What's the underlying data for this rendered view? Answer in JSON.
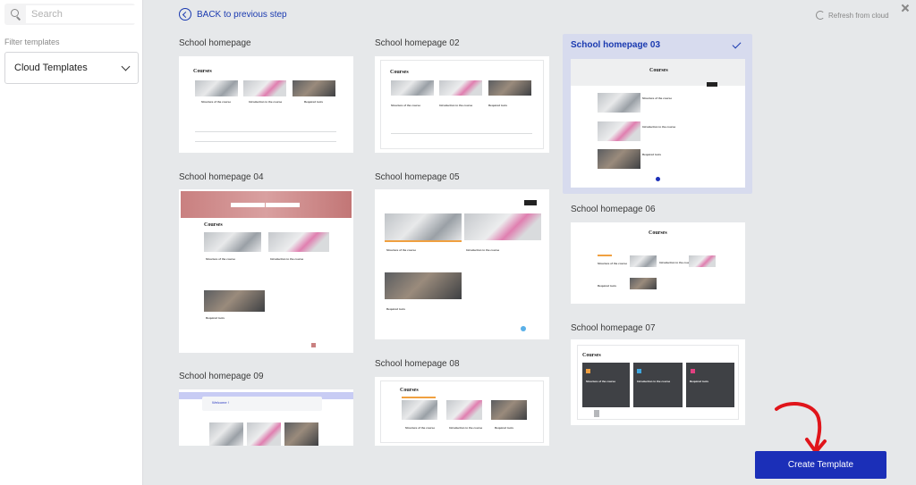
{
  "sidebar": {
    "search_placeholder": "Search",
    "filter_label": "Filter templates",
    "filter_value": "Cloud Templates"
  },
  "header": {
    "back_label": "BACK to previous step",
    "refresh_label": "Refresh from cloud"
  },
  "templates": [
    {
      "title": "School homepage",
      "selected": false
    },
    {
      "title": "School homepage 02",
      "selected": false
    },
    {
      "title": "School homepage 03",
      "selected": true
    },
    {
      "title": "School homepage 04",
      "selected": false
    },
    {
      "title": "School homepage 05",
      "selected": false
    },
    {
      "title": "School homepage 06",
      "selected": false
    },
    {
      "title": "School homepage 07",
      "selected": false
    },
    {
      "title": "School homepage 08",
      "selected": false
    },
    {
      "title": "School homepage 09",
      "selected": false
    }
  ],
  "thumb_text": {
    "courses": "Courses",
    "course_1": "Structure of the course",
    "course_2": "Introduction to the course",
    "course_3": "Required tools",
    "welcome": "Welcome !"
  },
  "footer": {
    "create_label": "Create Template"
  },
  "colors": {
    "accent": "#1b2fb8",
    "selected_bg": "#d7dbee",
    "arrow": "#e0151b"
  }
}
